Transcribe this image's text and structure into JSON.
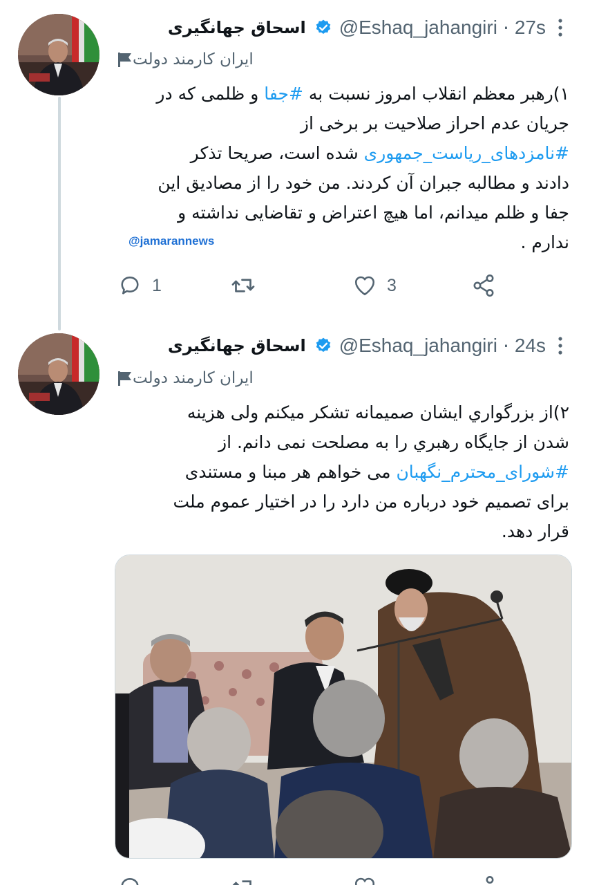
{
  "tweets": [
    {
      "author": {
        "name": "اسحاق جهانگیری",
        "handle": "@Eshaq_jahangiri",
        "verified": true,
        "label": "ایران کارمند دولت"
      },
      "time": "27s",
      "separator": "·",
      "text_lines": [
        [
          {
            "t": "۱)رهبر معظم انقلاب امروز نسبت به "
          },
          {
            "t": "#جفا",
            "tag": true
          },
          {
            "t": " و ظلمی که در"
          }
        ],
        [
          {
            "t": "جریان عدم احراز صلاحیت بر برخی از"
          }
        ],
        [
          {
            "t": "#نامزدهای_ریاست_جمهوری",
            "tag": true
          },
          {
            "t": " شده است، صریحا تذکر"
          }
        ],
        [
          {
            "t": "دادند و مطالبه جبران آن کردند. من خود را از مصادیق این"
          }
        ],
        [
          {
            "t": "جفا و ظلم میدانم، اما هیچ اعتراض و تقاضایی نداشته و"
          }
        ],
        [
          {
            "t": "ندارم ."
          }
        ]
      ],
      "watermark": "@jamarannews",
      "actions": {
        "reply_count": "1",
        "retweet_count": "",
        "like_count": "3"
      }
    },
    {
      "author": {
        "name": "اسحاق جهانگیری",
        "handle": "@Eshaq_jahangiri",
        "verified": true,
        "label": "ایران کارمند دولت"
      },
      "time": "24s",
      "separator": "·",
      "text_lines": [
        [
          {
            "t": "۲)از بزرگواري ايشان صميمانه تشکر ميکنم ولی هزينه"
          }
        ],
        [
          {
            "t": "شدن از  جايگاه رهبري را به مصلحت نمی دانم. از"
          }
        ],
        [
          {
            "t": "#شورای_محترم_نگهبان",
            "tag": true
          },
          {
            "t": " می خواهم هر مبنا و مستندی"
          }
        ],
        [
          {
            "t": "برای تصمیم خود درباره من دارد را در اختیار عموم ملت"
          }
        ],
        [
          {
            "t": "قرار دهد."
          }
        ]
      ],
      "media": {
        "kind": "photo"
      }
    }
  ],
  "colors": {
    "text": "#0f1419",
    "secondary": "#536471",
    "hashtag": "#1d9bf0",
    "verified": "#1d9bf0",
    "watermark": "#1d6fd4",
    "thread_line": "#cfd9de"
  },
  "icons": {
    "more": "more-vertical-icon",
    "verified": "verified-badge-icon",
    "label": "flag-icon",
    "reply": "reply-icon",
    "retweet": "retweet-icon",
    "like": "heart-icon",
    "share": "share-icon"
  }
}
